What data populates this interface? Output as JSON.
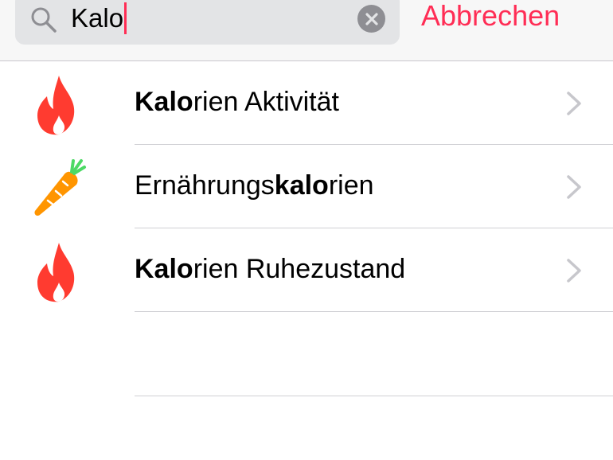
{
  "search": {
    "query": "Kalo",
    "cancel_label": "Abbrechen"
  },
  "colors": {
    "accent": "#ff2d55",
    "flame": "#ff3b30",
    "carrot": "#ff9500",
    "carrot_leaf": "#4cd964"
  },
  "results": [
    {
      "icon": "flame-icon",
      "prefix": "",
      "match": "Kalo",
      "suffix": "rien Aktivität"
    },
    {
      "icon": "carrot-icon",
      "prefix": "Ernährungs",
      "match": "kalo",
      "suffix": "rien"
    },
    {
      "icon": "flame-icon",
      "prefix": "",
      "match": "Kalo",
      "suffix": "rien Ruhezustand"
    }
  ]
}
